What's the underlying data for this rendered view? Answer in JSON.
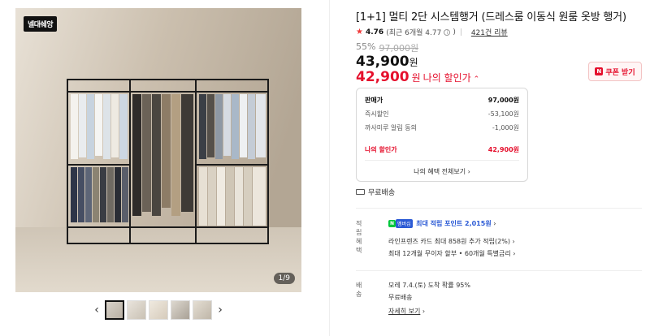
{
  "gallery": {
    "brand_badge": "넬대쉐앙",
    "counter": "1/9",
    "prev_icon": "chevron-left-icon",
    "next_icon": "chevron-right-icon",
    "thumb_count": 5
  },
  "product": {
    "title": "[1+1] 멀티 2단 시스템행거 (드레스룸 이동식 원룸 옷방 행거)",
    "rating": "4.76",
    "rating_recent": "(최근 6개월 4.77",
    "review_count": "421건 리뷰",
    "discount_pct": "55%",
    "original_price": "97,000원",
    "sale_price": "43,900",
    "won": "원",
    "my_price": "42,900",
    "my_price_label": "나의 할인가",
    "coupon_label": "쿠폰 받기"
  },
  "price_box": {
    "rows": [
      {
        "label": "판매가",
        "value": "97,000원"
      },
      {
        "label": "즉시할인",
        "value": "-53,100원"
      },
      {
        "label": "까사미루 알림 동의",
        "value": "-1,000원"
      }
    ],
    "mine_label": "나의 할인가",
    "mine_value": "42,900원",
    "more_label": "나의 혜택 전체보기"
  },
  "shipping_top": "무료배송",
  "benefits": {
    "point_label": "적립",
    "npay": "N",
    "npay_plus": "멤버십",
    "point_text": "최대 적립 포인트 2,015원",
    "benefit_label": "혜택",
    "benefit_line1": "라인프렌즈 카드 최대 858원 추가 적립(2%)",
    "benefit_line2": "최대 12개월 무이자 할부 • 60개월 특별금리",
    "delivery_label": "배송",
    "delivery_line1": "모레 7.4.(토) 도착 확률 95%",
    "delivery_line2": "무료배송",
    "delivery_link": "자세히 보기"
  }
}
